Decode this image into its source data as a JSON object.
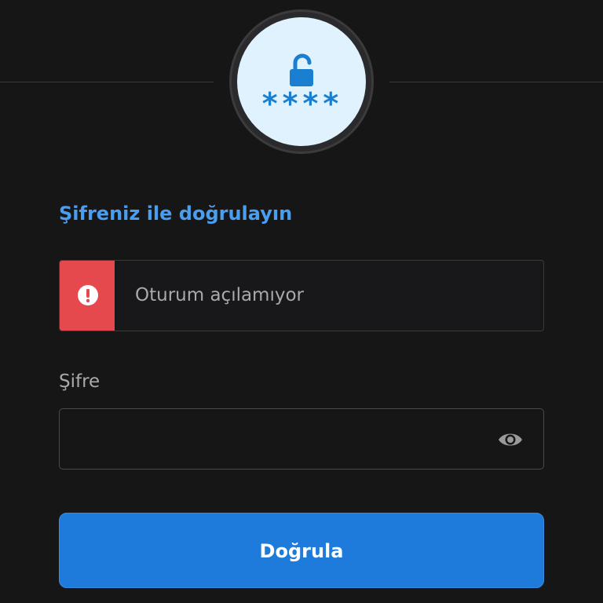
{
  "header": {
    "badge_icon": "lock-open-icon",
    "pin_mask_text": "****"
  },
  "main": {
    "heading": "Şifreniz ile doğrulayın",
    "alert": {
      "icon": "exclamation-circle-icon",
      "message": "Oturum açılamıyor",
      "color": "#e5484d"
    },
    "password_field": {
      "label": "Şifre",
      "value": "",
      "placeholder": "",
      "toggle_icon": "eye-icon"
    },
    "submit_label": "Doğrula"
  },
  "colors": {
    "background": "#161617",
    "accent": "#1e7bdc",
    "heading": "#4a9ef0",
    "badge_bg": "#dff2fd"
  }
}
